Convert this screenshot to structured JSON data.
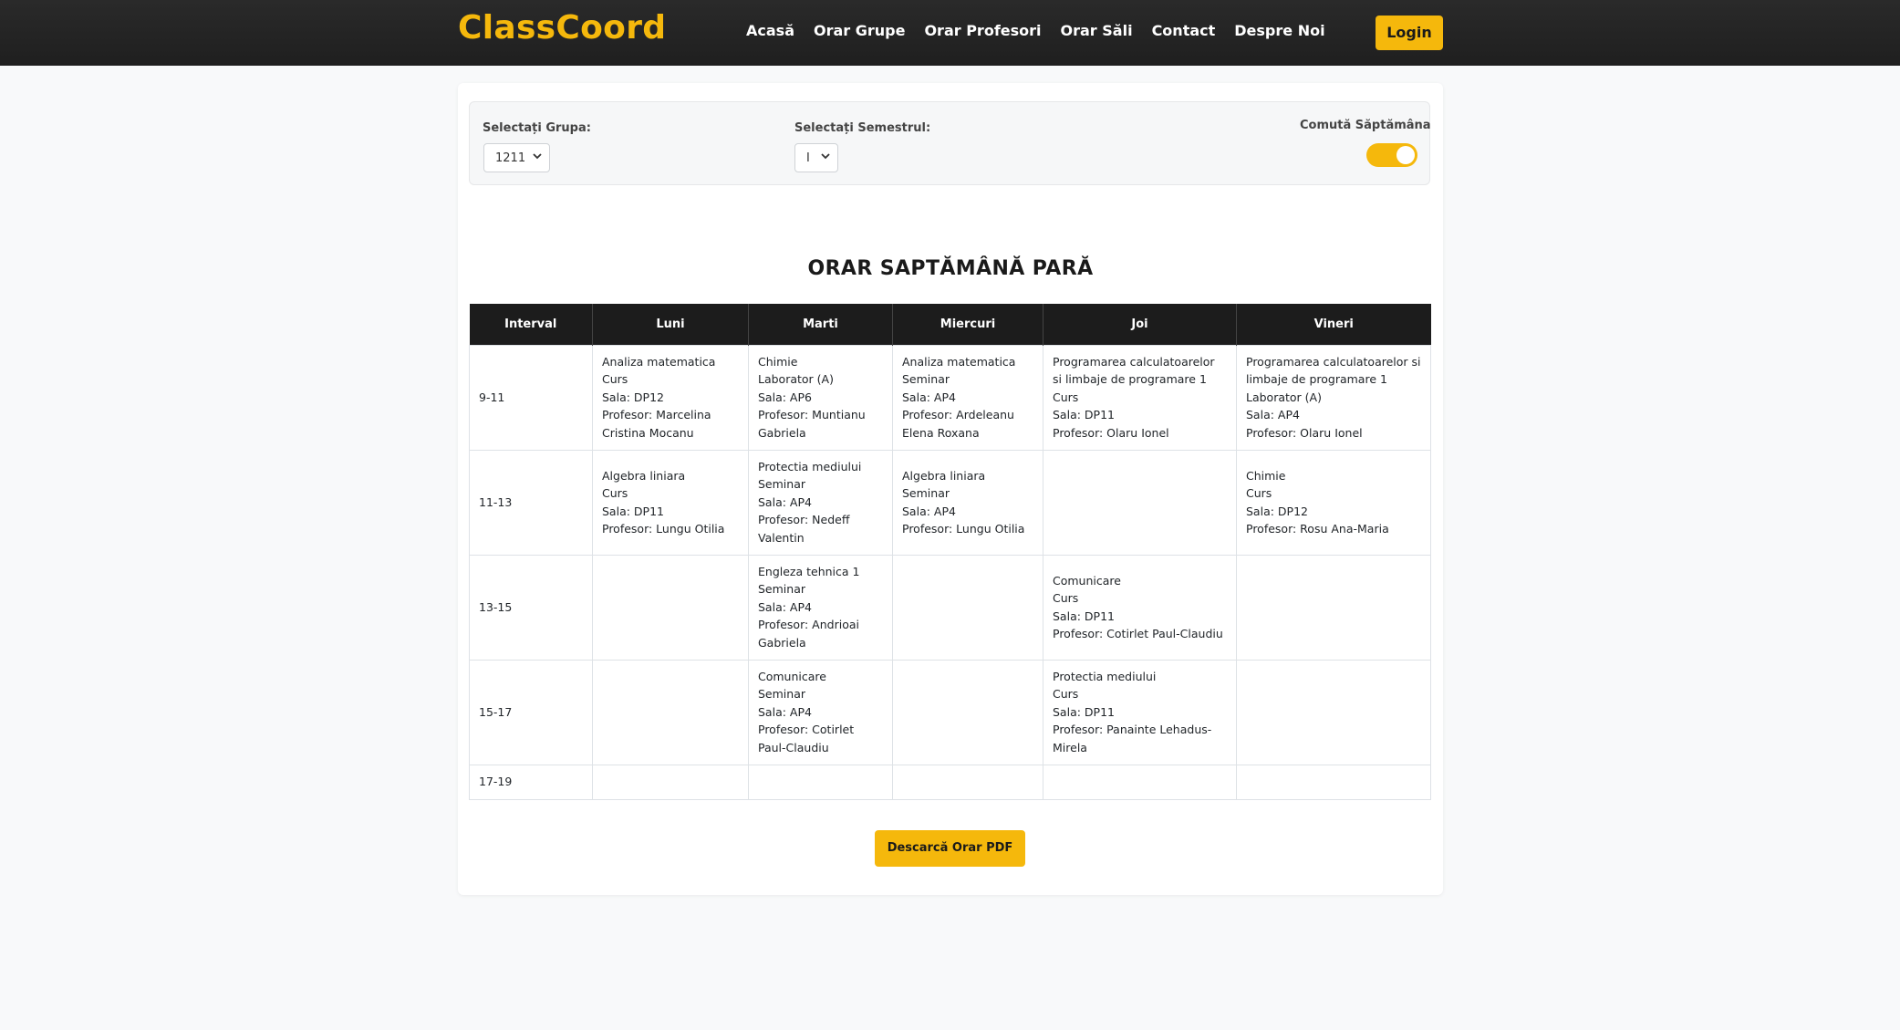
{
  "brand": "ClassCoord",
  "nav": [
    "Acasă",
    "Orar Grupe",
    "Orar Profesori",
    "Orar Săli",
    "Contact",
    "Despre Noi"
  ],
  "login_label": "Login",
  "filters": {
    "group_label": "Selectați Grupa:",
    "group_value": "1211",
    "semester_label": "Selectați Semestrul:",
    "semester_value": "I",
    "toggle_label": "Comută Săptămâna",
    "toggle_on": true
  },
  "schedule_title": "ORAR SAPTĂMÂNĂ PARĂ",
  "table": {
    "headers": [
      "Interval",
      "Luni",
      "Marti",
      "Miercuri",
      "Joi",
      "Vineri"
    ],
    "rows": [
      {
        "interval": "9-11",
        "cells": [
          [
            "Analiza matematica",
            "Curs",
            "Sala: DP12",
            "Profesor: Marcelina Cristina Mocanu"
          ],
          [
            "Chimie",
            "Laborator (A)",
            "Sala: AP6",
            "Profesor: Muntianu Gabriela"
          ],
          [
            "Analiza matematica",
            "Seminar",
            "Sala: AP4",
            "Profesor: Ardeleanu Elena Roxana"
          ],
          [
            "Programarea calculatoarelor si limbaje de programare 1",
            "Curs",
            "Sala: DP11",
            "Profesor: Olaru Ionel"
          ],
          [
            "Programarea calculatoarelor si limbaje de programare 1",
            "Laborator (A)",
            "Sala: AP4",
            "Profesor: Olaru Ionel"
          ]
        ]
      },
      {
        "interval": "11-13",
        "cells": [
          [
            "Algebra liniara",
            "Curs",
            "Sala: DP11",
            "Profesor: Lungu Otilia"
          ],
          [
            "Protectia mediului",
            "Seminar",
            "Sala: AP4",
            "Profesor: Nedeff Valentin"
          ],
          [
            "Algebra liniara",
            "Seminar",
            "Sala: AP4",
            "Profesor: Lungu Otilia"
          ],
          [],
          [
            "Chimie",
            "Curs",
            "Sala: DP12",
            "Profesor: Rosu Ana-Maria"
          ]
        ]
      },
      {
        "interval": "13-15",
        "cells": [
          [],
          [
            "Engleza tehnica 1",
            "Seminar",
            "Sala: AP4",
            "Profesor: Andrioai Gabriela"
          ],
          [],
          [
            "Comunicare",
            "Curs",
            "Sala: DP11",
            "Profesor: Cotirlet Paul-Claudiu"
          ],
          []
        ]
      },
      {
        "interval": "15-17",
        "cells": [
          [],
          [
            "Comunicare",
            "Seminar",
            "Sala: AP4",
            "Profesor: Cotirlet Paul-Claudiu"
          ],
          [],
          [
            "Protectia mediului",
            "Curs",
            "Sala: DP11",
            "Profesor: Panainte Lehadus-Mirela"
          ],
          []
        ]
      },
      {
        "interval": "17-19",
        "cells": [
          [],
          [],
          [],
          [],
          []
        ]
      }
    ]
  },
  "download_label": "Descarcă Orar PDF",
  "colors": {
    "accent": "#f5b80c",
    "navbar": "#1f1f1f",
    "table_header": "#1c1c1c"
  }
}
